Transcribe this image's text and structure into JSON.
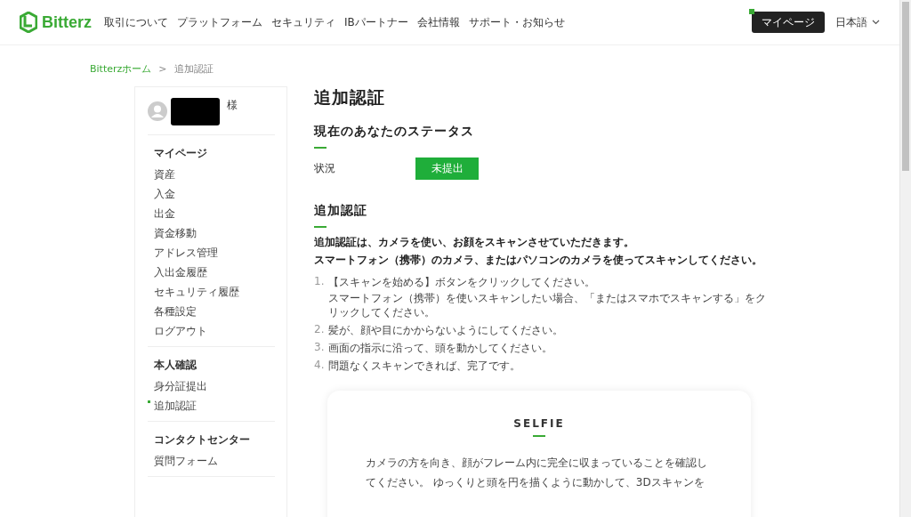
{
  "header": {
    "logo": "Bitterz",
    "nav": [
      "取引について",
      "プラットフォーム",
      "セキュリティ",
      "IBパートナー",
      "会社情報",
      "サポート・お知らせ"
    ],
    "mypage_button": "マイページ",
    "language": "日本語"
  },
  "breadcrumb": {
    "home": "Bitterzホーム",
    "separator": ">",
    "current": "追加認証"
  },
  "sidebar": {
    "user_suffix": "様",
    "groups": [
      {
        "title": "マイページ",
        "items": [
          {
            "label": "資産",
            "selected": false
          },
          {
            "label": "入金",
            "selected": false
          },
          {
            "label": "出金",
            "selected": false
          },
          {
            "label": "資金移動",
            "selected": false
          },
          {
            "label": "アドレス管理",
            "selected": false
          },
          {
            "label": "入出金履歴",
            "selected": false
          },
          {
            "label": "セキュリティ履歴",
            "selected": false
          },
          {
            "label": "各種設定",
            "selected": false
          },
          {
            "label": "ログアウト",
            "selected": false
          }
        ]
      },
      {
        "title": "本人確認",
        "items": [
          {
            "label": "身分証提出",
            "selected": false
          },
          {
            "label": "追加認証",
            "selected": true
          }
        ]
      },
      {
        "title": "コンタクトセンター",
        "items": [
          {
            "label": "質問フォーム",
            "selected": false
          }
        ]
      }
    ]
  },
  "main": {
    "title": "追加認証",
    "status_section": {
      "heading": "現在のあなたのステータス",
      "label": "状況",
      "value": "未提出"
    },
    "verify_section": {
      "heading": "追加認証",
      "intro": [
        "追加認証は、カメラを使い、お顔をスキャンさせていただきます。",
        "スマートフォン（携帯）のカメラ、またはパソコンのカメラを使ってスキャンしてください。"
      ],
      "steps": [
        {
          "number": "1.",
          "lines": [
            "【スキャンを始める】ボタンをクリックしてください。",
            "スマートフォン（携帯）を使いスキャンしたい場合、「またはスマホでスキャンする」をクリックしてください。"
          ]
        },
        {
          "number": "2.",
          "lines": [
            "髪が、顔や目にかからないようにしてください。"
          ]
        },
        {
          "number": "3.",
          "lines": [
            "画面の指示に沿って、頭を動かしてください。"
          ]
        },
        {
          "number": "4.",
          "lines": [
            "問題なくスキャンできれば、完了です。"
          ]
        }
      ]
    },
    "selfie_card": {
      "title": "SELFIE",
      "text": "カメラの方を向き、顔がフレーム内に完全に収まっていることを確認してください。 ゆっくりと頭を円を描くように動かして、3Dスキャンを"
    }
  }
}
